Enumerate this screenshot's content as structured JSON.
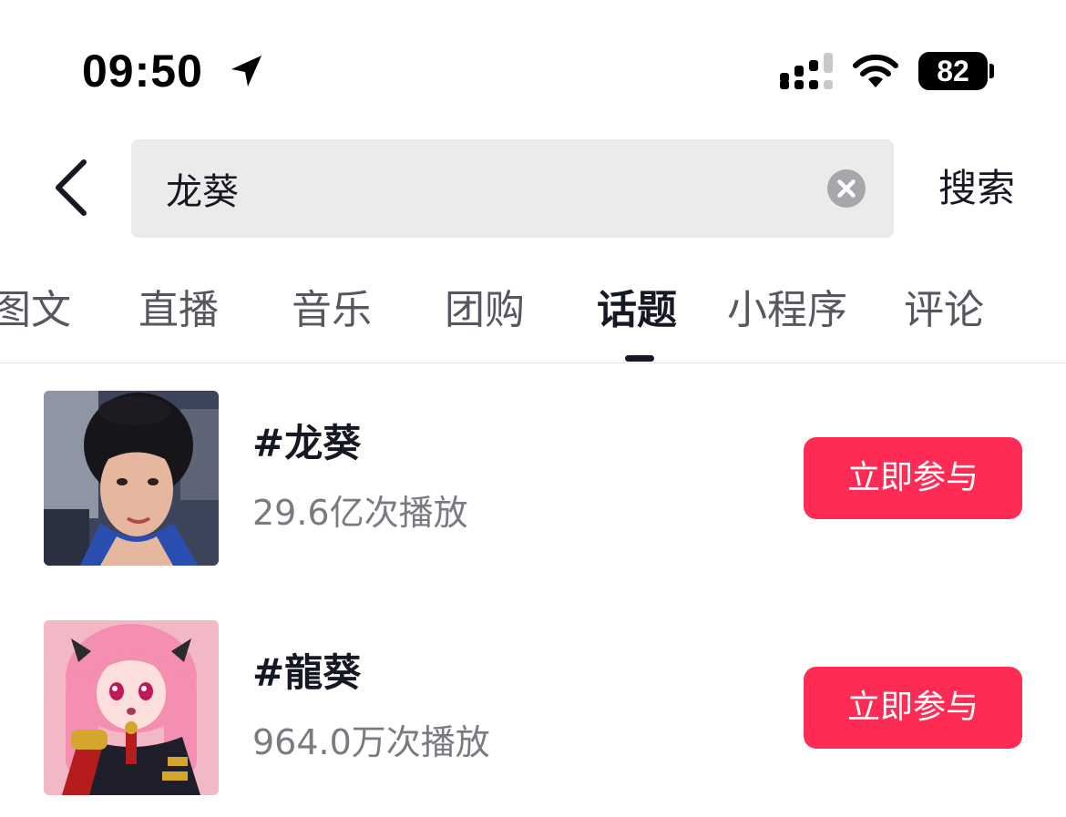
{
  "status_bar": {
    "time": "09:50",
    "battery": "82"
  },
  "search": {
    "query": "龙葵",
    "submit_label": "搜索"
  },
  "tabs": [
    {
      "label": "图文"
    },
    {
      "label": "直播"
    },
    {
      "label": "音乐"
    },
    {
      "label": "团购"
    },
    {
      "label": "话题",
      "active": true
    },
    {
      "label": "小程序"
    },
    {
      "label": "评论"
    }
  ],
  "topics": [
    {
      "title": "#龙葵",
      "plays": "29.6亿次播放",
      "action": "立即参与"
    },
    {
      "title": "#龍葵",
      "plays": "964.0万次播放",
      "action": "立即参与"
    }
  ],
  "colors": {
    "accent": "#fe2c55",
    "text_primary": "#161823",
    "text_secondary": "#7a7b80",
    "search_bg": "#ebebeb"
  }
}
